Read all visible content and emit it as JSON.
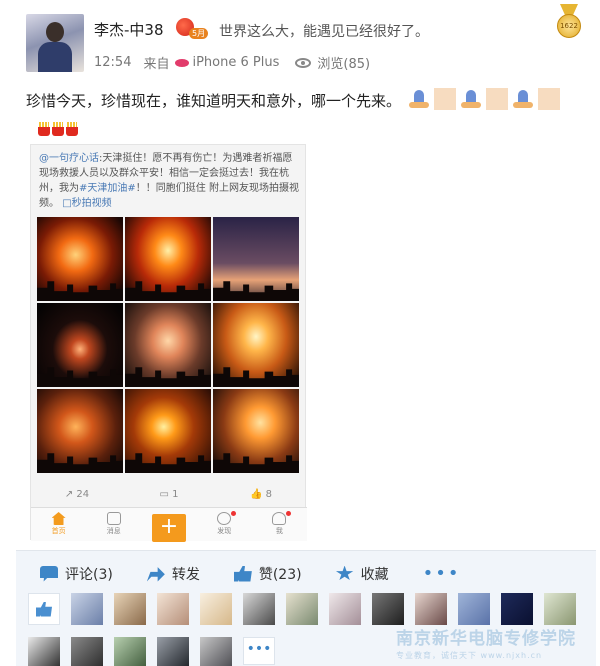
{
  "header": {
    "username": "李杰-中38",
    "level": "5月",
    "signature": "世界这么大，能遇见已经很好了。",
    "medal_text": "1622"
  },
  "meta": {
    "time": "12:54",
    "source_prefix": "来自",
    "device": "iPhone 6 Plus",
    "views": "浏览(85)"
  },
  "post": {
    "text": "珍惜今天，珍惜现在，谁知道明天和意外，哪一个先来。"
  },
  "repost": {
    "author": "@一句疗心话",
    "body": ":天津挺住！愿不再有伤亡！为遇难者祈福愿现场救援人员以及群众平安！相信一定会挺过去！我在杭州，我为",
    "hashtag": "#天津加油#",
    "tail": "！！同胞们挺住 附上网友现场拍摄视频。",
    "video_link": "□秒拍视频",
    "counts": {
      "repost": "24",
      "comment": "1",
      "like": "8"
    },
    "tabs": [
      "首页",
      "消息",
      "+",
      "发现",
      "我"
    ]
  },
  "actions": {
    "comment": "评论(3)",
    "repost": "转发",
    "like": "赞(23)",
    "favorite": "收藏",
    "more": "•••"
  },
  "likers_more": "•••",
  "watermark": {
    "main": "南京新华电脑专修学院",
    "sub": "专业教育，诚信天下 www.njxh.cn"
  }
}
